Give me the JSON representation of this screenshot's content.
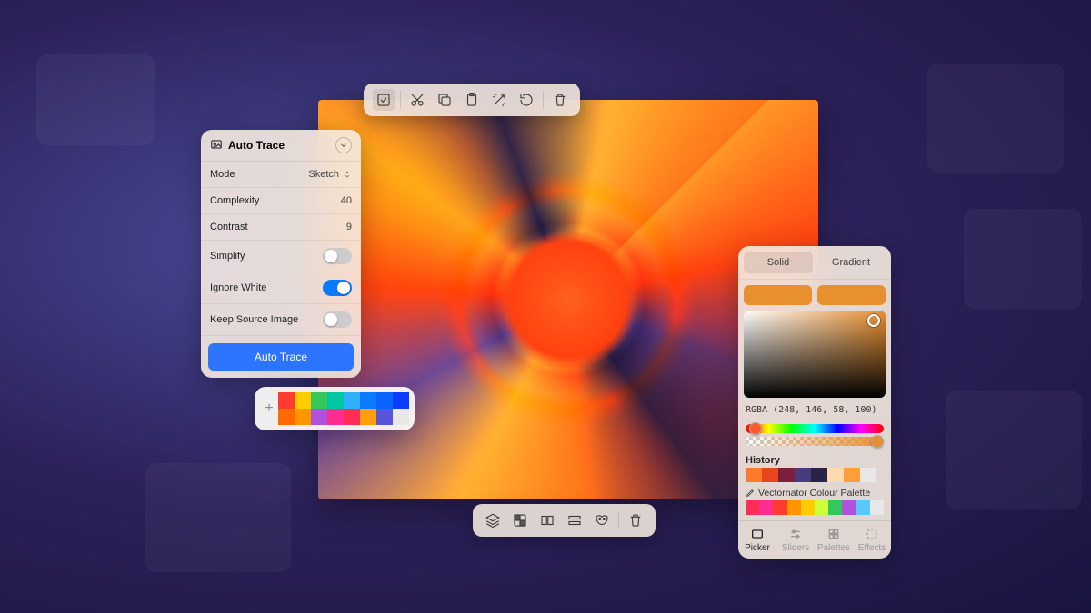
{
  "autotrace": {
    "title": "Auto Trace",
    "mode_label": "Mode",
    "mode_value": "Sketch",
    "complexity_label": "Complexity",
    "complexity_value": "40",
    "contrast_label": "Contrast",
    "contrast_value": "9",
    "simplify_label": "Simplify",
    "simplify_on": false,
    "ignore_white_label": "Ignore White",
    "ignore_white_on": true,
    "keep_source_label": "Keep Source Image",
    "keep_source_on": false,
    "button": "Auto Trace"
  },
  "top_toolbar": {
    "icons": [
      "select",
      "cut",
      "copy",
      "paste",
      "magic",
      "rotate",
      "trash"
    ]
  },
  "bottom_toolbar": {
    "icons": [
      "layers",
      "grid",
      "split",
      "lines",
      "mask",
      "trash"
    ]
  },
  "palette": {
    "colors_row1": [
      "#ff3b2f",
      "#ffcc00",
      "#34c759",
      "#00c7a3",
      "#30b0ff",
      "#0a7bff",
      "#0a64ff",
      "#0a3dff"
    ],
    "colors_row2": [
      "#ff6a00",
      "#ff9500",
      "#af52de",
      "#ff2d92",
      "#ff2d55",
      "#ff9f0a",
      "#5856d6",
      "#e8e8e8"
    ]
  },
  "color_panel": {
    "solid_label": "Solid",
    "gradient_label": "Gradient",
    "current_color": "#e89030",
    "rgba_text": "RGBA (248, 146, 58, 100)",
    "history_label": "History",
    "history": [
      "#ff7a2d",
      "#e8471e",
      "#7a1f3c",
      "#4a3b7a",
      "#2a2348",
      "#ffd9b0",
      "#ff9f3c",
      "#e8e8e8"
    ],
    "library_label": "Vectornator Colour Palette",
    "library": [
      "#ff2d55",
      "#ff2d92",
      "#ff3b2f",
      "#ff9500",
      "#ffcc00",
      "#cfff3c",
      "#34c759",
      "#af52de",
      "#5ac8fa",
      "#e8e8e8"
    ],
    "tabs": {
      "picker": "Picker",
      "sliders": "Sliders",
      "palettes": "Palettes",
      "effects": "Effects"
    }
  }
}
